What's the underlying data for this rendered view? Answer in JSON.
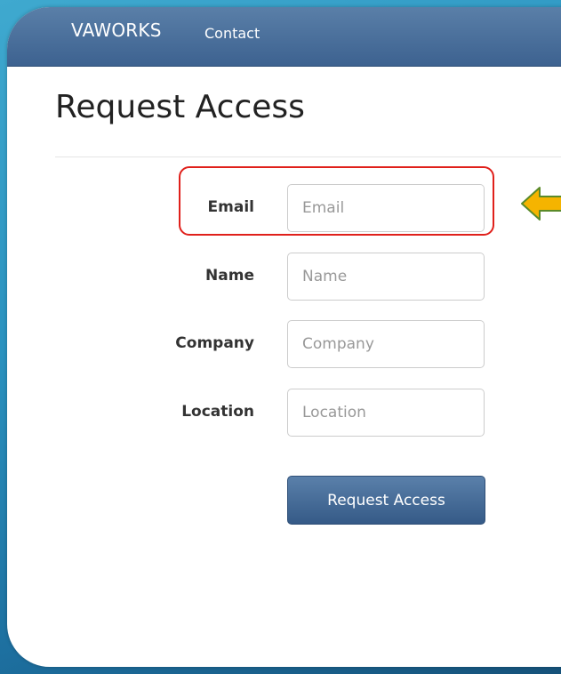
{
  "navbar": {
    "brand": "VAWORKS",
    "links": [
      "Contact"
    ]
  },
  "page": {
    "title": "Request Access"
  },
  "form": {
    "fields": [
      {
        "label": "Email",
        "placeholder": "Email",
        "value": ""
      },
      {
        "label": "Name",
        "placeholder": "Name",
        "value": ""
      },
      {
        "label": "Company",
        "placeholder": "Company",
        "value": ""
      },
      {
        "label": "Location",
        "placeholder": "Location",
        "value": ""
      }
    ],
    "submit_label": "Request Access"
  },
  "annotations": {
    "highlight_color": "#e0201b",
    "arrow_color": "#f5b400",
    "arrow_outline_color": "#5a8a2a"
  },
  "colors": {
    "navbar": "#3d6290",
    "button": "#355a87",
    "background": "#2a92bf"
  }
}
